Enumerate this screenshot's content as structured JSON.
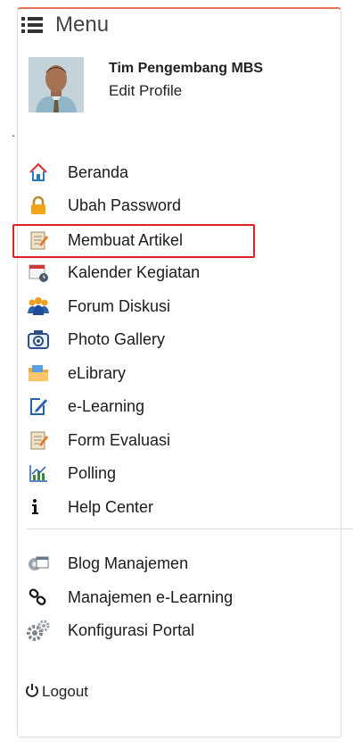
{
  "menu": {
    "title": "Menu",
    "icon": "list-icon"
  },
  "profile": {
    "name": "Tim Pengembang MBS",
    "edit_label": "Edit Profile"
  },
  "dot": ".",
  "items": [
    {
      "label": "Beranda",
      "icon": "home-icon"
    },
    {
      "label": "Ubah Password",
      "icon": "lock-icon"
    },
    {
      "label": "Membuat Artikel",
      "icon": "notepad-icon"
    },
    {
      "label": "Kalender Kegiatan",
      "icon": "calendar-icon"
    },
    {
      "label": "Forum Diskusi",
      "icon": "people-icon"
    },
    {
      "label": "Photo Gallery",
      "icon": "camera-icon"
    },
    {
      "label": "eLibrary",
      "icon": "folder-icon"
    },
    {
      "label": "e-Learning",
      "icon": "edit-icon"
    },
    {
      "label": "Form Evaluasi",
      "icon": "form-icon"
    },
    {
      "label": "Polling",
      "icon": "chart-icon"
    },
    {
      "label": "Help Center",
      "icon": "info-icon"
    }
  ],
  "admin_items": [
    {
      "label": "Blog Manajemen",
      "icon": "blog-settings-icon"
    },
    {
      "label": "Manajemen e-Learning",
      "icon": "link-icon"
    },
    {
      "label": "Konfigurasi Portal",
      "icon": "gears-icon"
    }
  ],
  "logout": {
    "label": "Logout",
    "icon": "power-icon"
  }
}
